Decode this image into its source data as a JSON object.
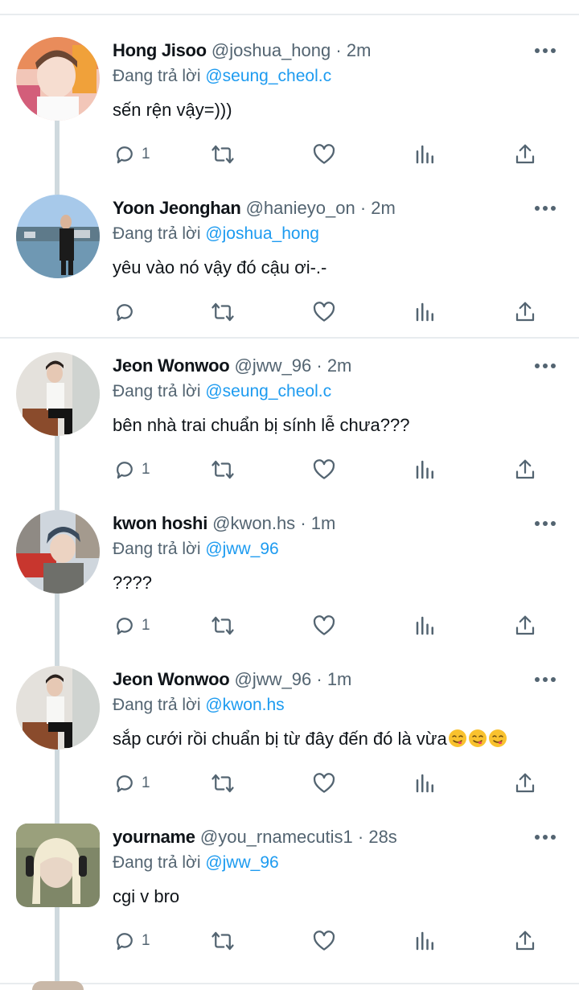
{
  "tweets": [
    {
      "name": "Hong Jisoo",
      "handle": "@joshua_hong",
      "time": "2m",
      "reply_prefix": "Đang trả lời",
      "reply_to": "@seung_cheol.c",
      "text": "sến rện vậy=)))",
      "reply_count": "1"
    },
    {
      "name": "Yoon Jeonghan",
      "handle": "@hanieyo_on",
      "time": "2m",
      "reply_prefix": "Đang trả lời",
      "reply_to": "@joshua_hong",
      "text": "yêu vào nó vậy đó cậu ơi-.-",
      "reply_count": ""
    },
    {
      "name": "Jeon Wonwoo",
      "handle": "@jww_96",
      "time": "2m",
      "reply_prefix": "Đang trả lời",
      "reply_to": "@seung_cheol.c",
      "text": "bên nhà trai chuẩn bị sính lễ chưa???",
      "reply_count": "1"
    },
    {
      "name": "kwon hoshi",
      "handle": "@kwon.hs",
      "time": "1m",
      "reply_prefix": "Đang trả lời",
      "reply_to": "@jww_96",
      "text": "????",
      "reply_count": "1"
    },
    {
      "name": "Jeon Wonwoo",
      "handle": "@jww_96",
      "time": "1m",
      "reply_prefix": "Đang trả lời",
      "reply_to": "@kwon.hs",
      "text": "sắp cưới rồi chuẩn bị từ đây đến đó là vừa",
      "reply_count": "1"
    },
    {
      "name": "yourname",
      "handle": "@you_rnamecutis1",
      "time": "28s",
      "reply_prefix": "Đang trả lời",
      "reply_to": "@jww_96",
      "text": "cgi v bro",
      "reply_count": "1"
    }
  ],
  "separator": "·",
  "icons": {
    "more": "more-dots-icon",
    "reply": "reply-icon",
    "retweet": "retweet-icon",
    "like": "heart-icon",
    "views": "views-chart-icon",
    "share": "share-icon",
    "emoji": "savoring-food-emoji-icon"
  },
  "colors": {
    "mention": "#1d9bf0",
    "secondary_text": "#536471",
    "divider": "#e8ecef",
    "thread_line": "#cfd9de"
  }
}
